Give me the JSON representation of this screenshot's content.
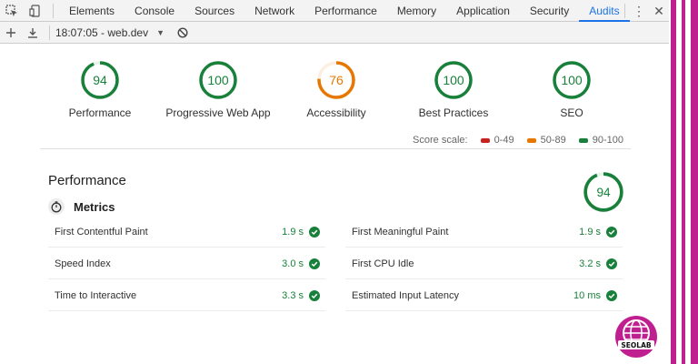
{
  "devtools": {
    "tabs": [
      "Elements",
      "Console",
      "Sources",
      "Network",
      "Performance",
      "Memory",
      "Application",
      "Security",
      "Audits"
    ],
    "active_tab": "Audits"
  },
  "toolbar": {
    "report": "18:07:05 - web.dev"
  },
  "categories": [
    {
      "label": "Performance",
      "score": 94,
      "color": "#18803a"
    },
    {
      "label": "Progressive Web App",
      "score": 100,
      "color": "#18803a"
    },
    {
      "label": "Accessibility",
      "score": 76,
      "color": "#e67700"
    },
    {
      "label": "Best Practices",
      "score": 100,
      "color": "#18803a"
    },
    {
      "label": "SEO",
      "score": 100,
      "color": "#18803a"
    }
  ],
  "score_scale": {
    "label": "Score scale:",
    "ranges": [
      {
        "label": "0-49",
        "color": "#c7221f"
      },
      {
        "label": "50-89",
        "color": "#e67700"
      },
      {
        "label": "90-100",
        "color": "#18803a"
      }
    ]
  },
  "performance": {
    "title": "Performance",
    "score": 94,
    "metrics_title": "Metrics",
    "metrics": [
      {
        "name": "First Contentful Paint",
        "value": "1.9 s"
      },
      {
        "name": "First Meaningful Paint",
        "value": "1.9 s"
      },
      {
        "name": "Speed Index",
        "value": "3.0 s"
      },
      {
        "name": "First CPU Idle",
        "value": "3.2 s"
      },
      {
        "name": "Time to Interactive",
        "value": "3.3 s"
      },
      {
        "name": "Estimated Input Latency",
        "value": "10 ms"
      }
    ]
  },
  "logo": {
    "text": "SEOLAB"
  }
}
